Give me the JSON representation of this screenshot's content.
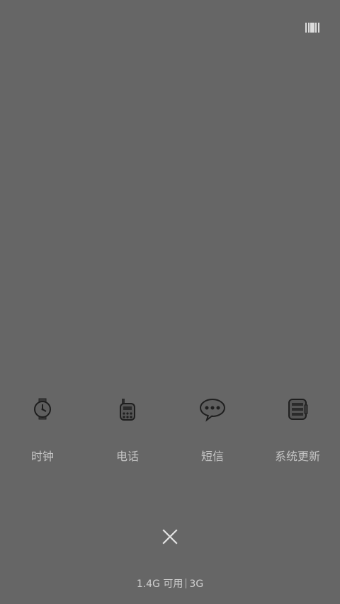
{
  "top_action": {
    "icon": "barcode-icon"
  },
  "apps": [
    {
      "label": "时钟",
      "icon": "clock-icon"
    },
    {
      "label": "电话",
      "icon": "phone-icon"
    },
    {
      "label": "短信",
      "icon": "message-icon"
    },
    {
      "label": "系统更新",
      "icon": "system-update-icon"
    }
  ],
  "close": {
    "icon": "close-icon"
  },
  "memory": {
    "available_text": "1.4G 可用",
    "total_text": "3G"
  }
}
